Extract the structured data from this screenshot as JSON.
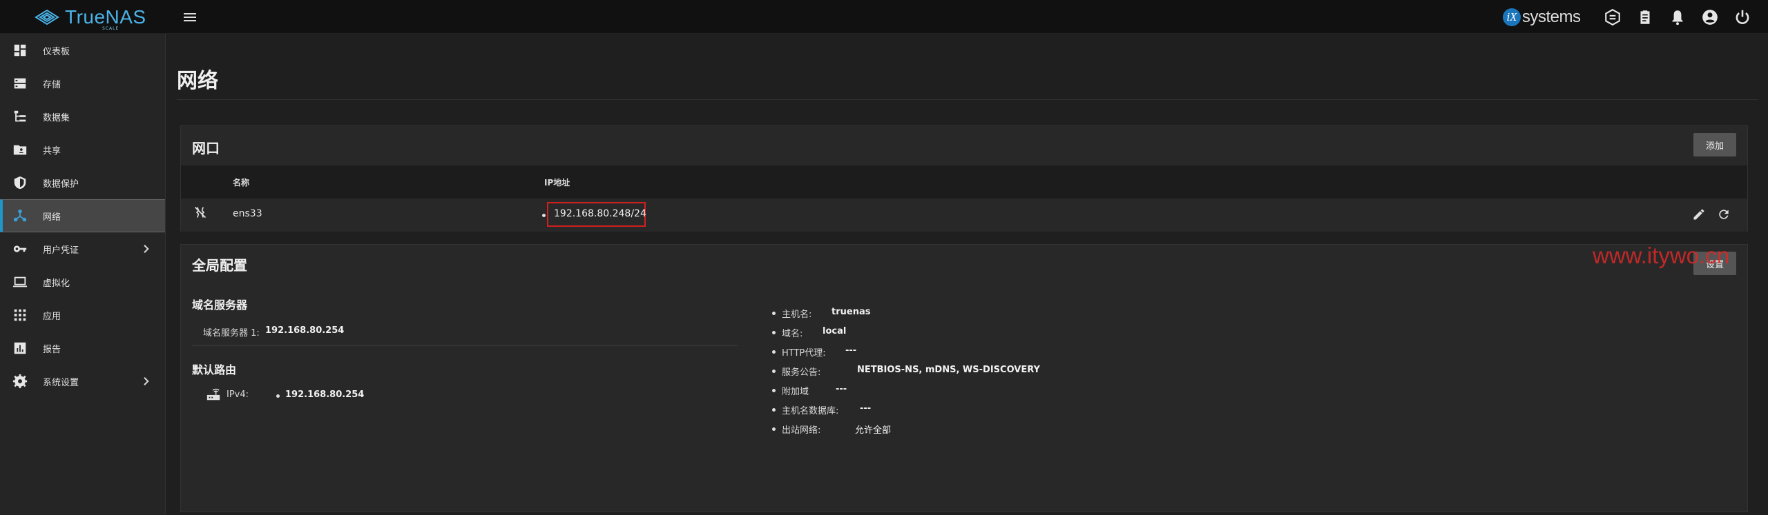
{
  "topbar": {
    "brand_name": "TrueNAS",
    "brand_edition": "SCALE",
    "ix_mark": "iX",
    "ix_text": "systems"
  },
  "sidebar": {
    "items": [
      {
        "label": "仪表板",
        "icon": "dashboard-icon"
      },
      {
        "label": "存储",
        "icon": "storage-icon"
      },
      {
        "label": "数据集",
        "icon": "dataset-tree-icon"
      },
      {
        "label": "共享",
        "icon": "folder-share-icon"
      },
      {
        "label": "数据保护",
        "icon": "shield-icon"
      },
      {
        "label": "网络",
        "icon": "network-icon",
        "active": true
      },
      {
        "label": "用户凭证",
        "icon": "key-icon",
        "expandable": true
      },
      {
        "label": "虚拟化",
        "icon": "laptop-icon"
      },
      {
        "label": "应用",
        "icon": "apps-grid-icon"
      },
      {
        "label": "报告",
        "icon": "bar-chart-icon"
      },
      {
        "label": "系统设置",
        "icon": "gear-icon",
        "expandable": true
      }
    ]
  },
  "page": {
    "title": "网络"
  },
  "interfaces": {
    "title": "网口",
    "add_label": "添加",
    "columns": [
      "名称",
      "IP地址"
    ],
    "rows": [
      {
        "name": "ens33",
        "ip": "192.168.80.248/24"
      }
    ]
  },
  "global_config": {
    "title": "全局配置",
    "settings_label": "设置",
    "dns_heading": "域名服务器",
    "dns_label": "域名服务器 1:",
    "dns_value": "192.168.80.254",
    "route_heading": "默认路由",
    "route_label": "IPv4:",
    "route_value": "192.168.80.254",
    "details": [
      {
        "label": "主机名:",
        "value": "truenas"
      },
      {
        "label": "域名:",
        "value": "local"
      },
      {
        "label": "HTTP代理:",
        "value": "---"
      },
      {
        "label": "服务公告:",
        "value": "NETBIOS-NS, mDNS, WS-DISCOVERY"
      },
      {
        "label": "附加域",
        "value": "---"
      },
      {
        "label": "主机名数据库:",
        "value": "---"
      },
      {
        "label": "出站网络:",
        "value": "允许全部"
      }
    ]
  },
  "watermark": "www.itywo.cn",
  "colors": {
    "accent": "#2196c9",
    "highlight_box": "#d01f1f",
    "brand": "#4bb3e8"
  }
}
